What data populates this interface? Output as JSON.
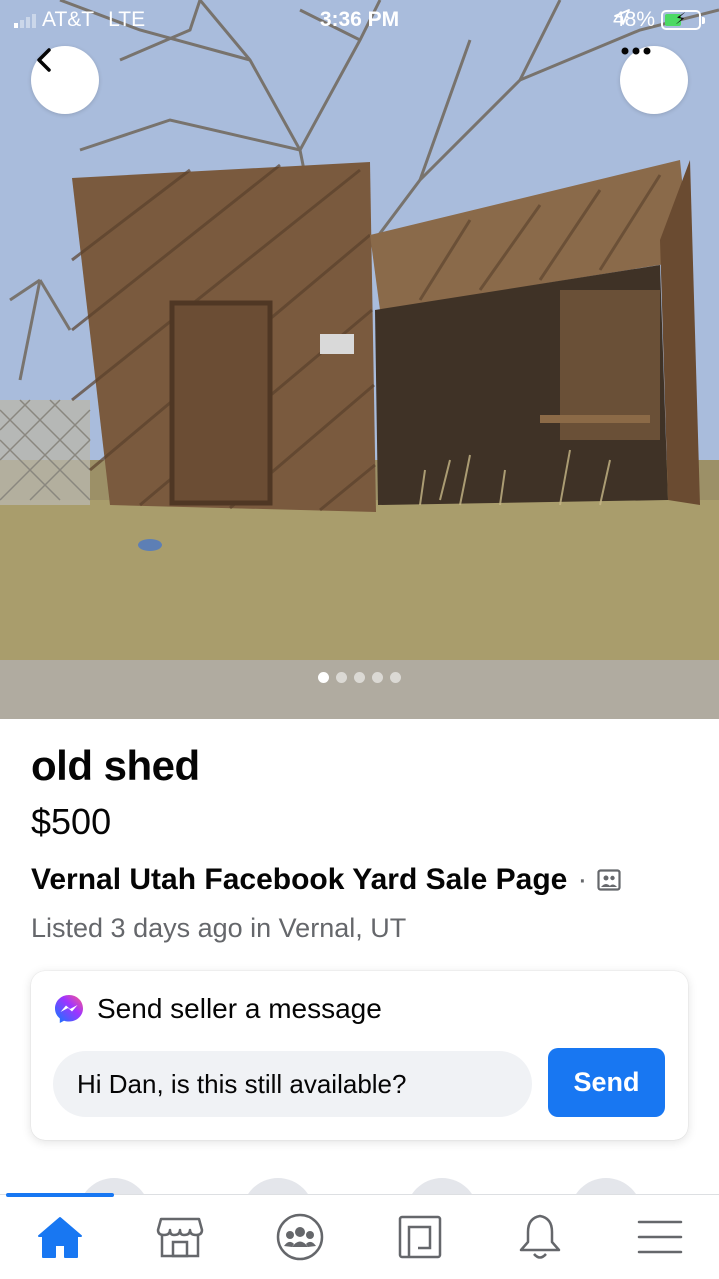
{
  "status_bar": {
    "carrier": "AT&T",
    "network": "LTE",
    "time": "3:36 PM",
    "battery": "48%"
  },
  "photo": {
    "alt_icon": "shed-photo",
    "page_count": 5,
    "current_page": 1
  },
  "listing": {
    "title": "old shed",
    "price": "$500",
    "seller": "Vernal Utah Facebook Yard Sale Page",
    "separator": "·",
    "listed": "Listed 3 days ago in Vernal, UT"
  },
  "message": {
    "title": "Send seller a message",
    "input_value": "Hi Dan, is this still available?",
    "send_label": "Send"
  },
  "tabs": [
    {
      "icon": "home-icon",
      "active": true
    },
    {
      "icon": "marketplace-icon",
      "active": false
    },
    {
      "icon": "groups-icon",
      "active": false
    },
    {
      "icon": "news-icon",
      "active": false
    },
    {
      "icon": "bell-icon",
      "active": false
    },
    {
      "icon": "menu-icon",
      "active": false
    }
  ],
  "colors": {
    "accent": "#1877f2",
    "secondary_text": "#65676b",
    "input_bg": "#f0f2f5"
  }
}
